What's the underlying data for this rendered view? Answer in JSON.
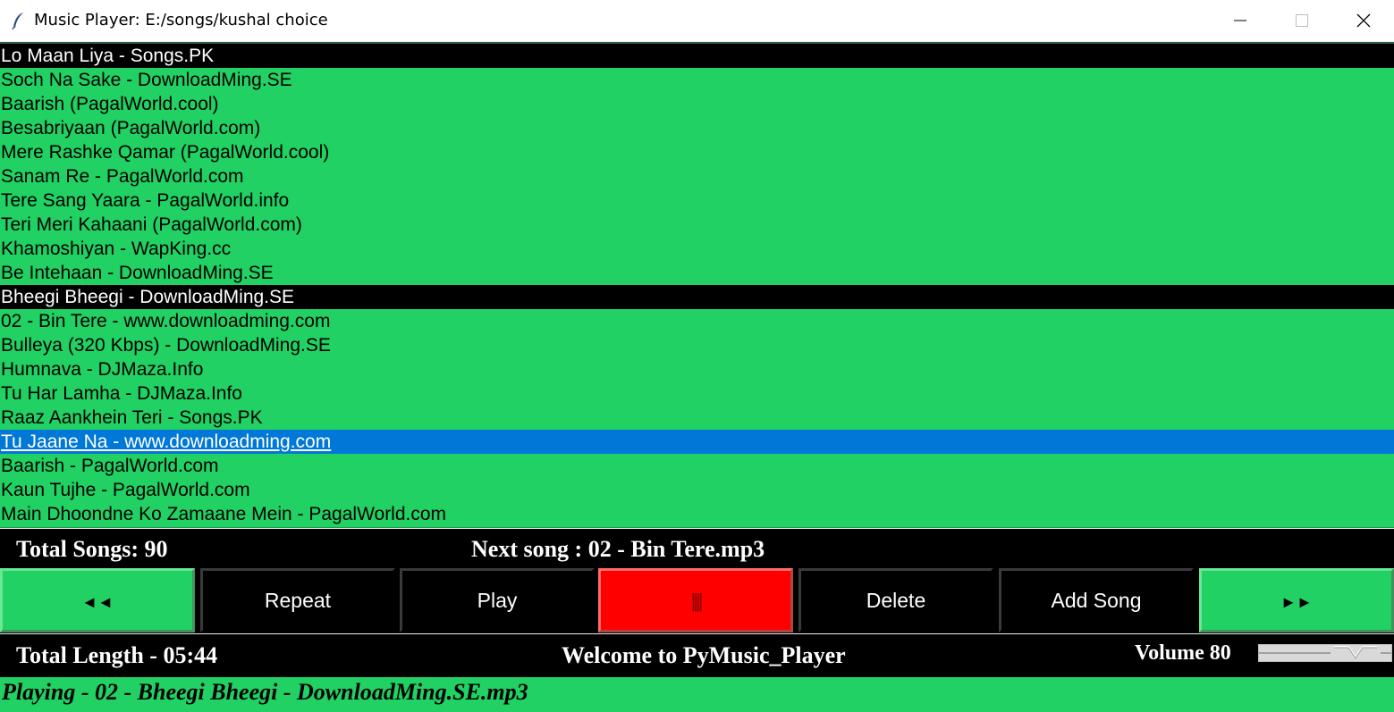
{
  "window": {
    "title": "Music Player: E:/songs/kushal choice",
    "icon": "feather-icon"
  },
  "playlist": {
    "songs": [
      {
        "label": "Lo Maan Liya - Songs.PK",
        "style": "black"
      },
      {
        "label": "Soch Na Sake -  DownloadMing.SE",
        "style": "normal"
      },
      {
        "label": "Baarish (PagalWorld.cool)",
        "style": "normal"
      },
      {
        "label": "Besabriyaan (PagalWorld.com)",
        "style": "normal"
      },
      {
        "label": "Mere Rashke Qamar (PagalWorld.cool)",
        "style": "normal"
      },
      {
        "label": "Sanam Re - PagalWorld.com",
        "style": "normal"
      },
      {
        "label": "Tere Sang Yaara - PagalWorld.info",
        "style": "normal"
      },
      {
        "label": "Teri Meri Kahaani (PagalWorld.com)",
        "style": "normal"
      },
      {
        "label": "Khamoshiyan - WapKing.cc",
        "style": "normal"
      },
      {
        "label": "Be Intehaan - DownloadMing.SE",
        "style": "normal"
      },
      {
        "label": "Bheegi Bheegi - DownloadMing.SE",
        "style": "black"
      },
      {
        "label": "02 - Bin Tere - www.downloadming.com",
        "style": "normal"
      },
      {
        "label": "Bulleya (320 Kbps) -  DownloadMing.SE",
        "style": "normal"
      },
      {
        "label": "Humnava - DJMaza.Info",
        "style": "normal"
      },
      {
        "label": "Tu Har Lamha - DJMaza.Info",
        "style": "normal"
      },
      {
        "label": "Raaz Aankhein Teri - Songs.PK",
        "style": "normal"
      },
      {
        "label": "Tu Jaane Na - www.downloadming.com",
        "style": "selected"
      },
      {
        "label": "Baarish - PagalWorld.com",
        "style": "normal"
      },
      {
        "label": "Kaun Tujhe - PagalWorld.com",
        "style": "normal"
      },
      {
        "label": "Main Dhoondne Ko Zamaane Mein - PagalWorld.com",
        "style": "normal"
      }
    ]
  },
  "info": {
    "total_songs": "Total Songs: 90",
    "next_song": "Next song : 02 - Bin Tere.mp3"
  },
  "controls": {
    "prev_label": "◄◄",
    "repeat_label": "Repeat",
    "play_label": "Play",
    "pause_label": "||||",
    "delete_label": "Delete",
    "add_song_label": "Add Song",
    "next_label": "►►"
  },
  "bottom": {
    "total_length": "Total Length - 05:44",
    "welcome": "Welcome to PyMusic_Player",
    "volume_label": "Volume 80",
    "volume_value": 80
  },
  "status": {
    "playing": "Playing - 02 - Bheegi Bheegi - DownloadMing.SE.mp3"
  },
  "colors": {
    "list_bg": "#21d163",
    "selected_bg": "#0078d7",
    "pause_bg": "#ff0000",
    "bar_bg": "#000000"
  }
}
